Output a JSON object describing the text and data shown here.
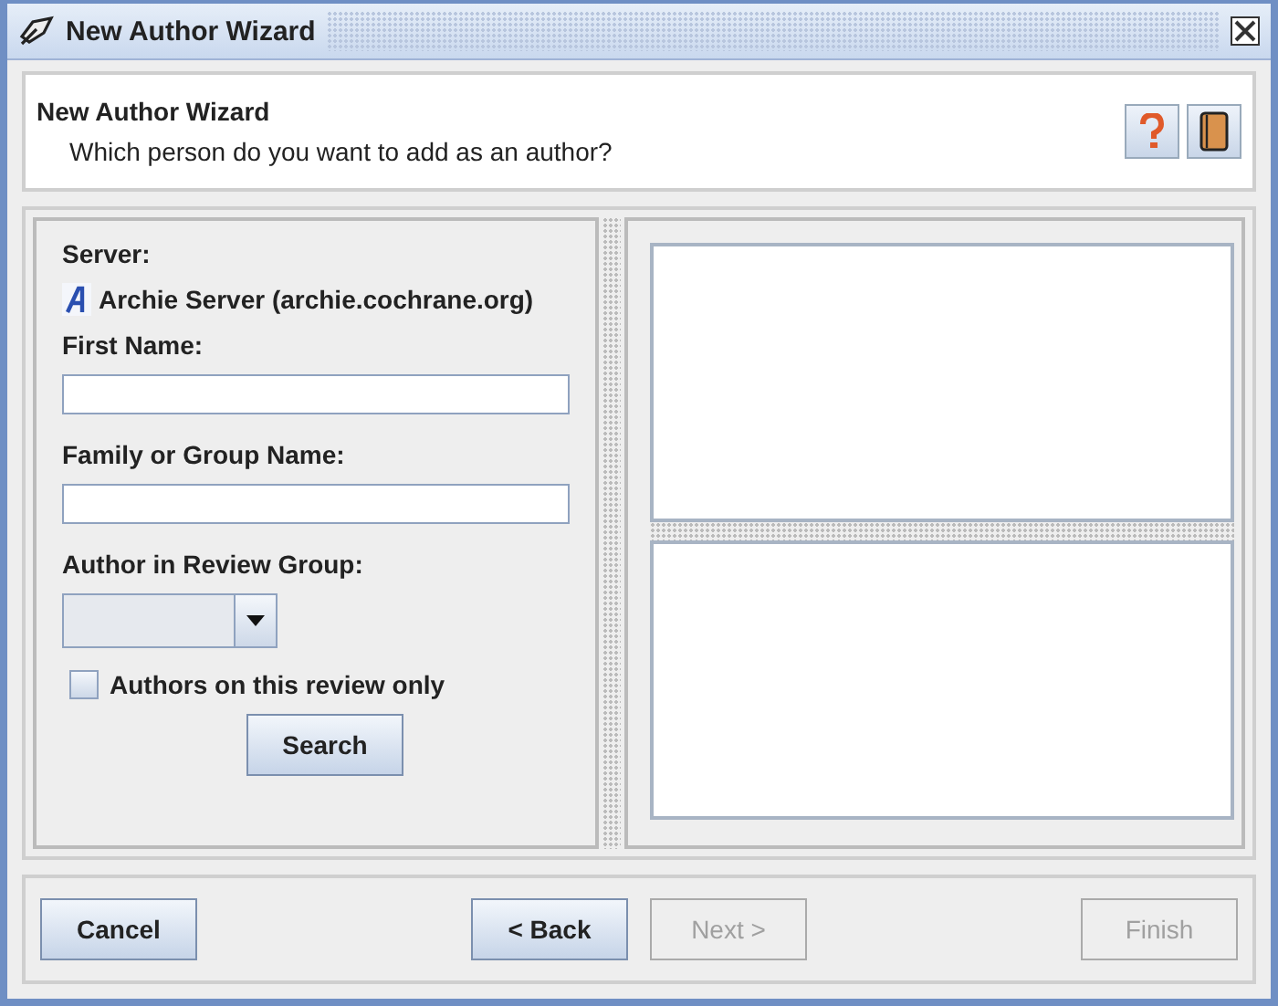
{
  "window": {
    "title": "New Author Wizard"
  },
  "header": {
    "title": "New Author Wizard",
    "subtitle": "Which person do you want to add as an author?"
  },
  "form": {
    "server_label": "Server:",
    "server": "Archie Server (archie.cochrane.org)",
    "fields": [
      {
        "label": "First Name:",
        "kind": "text"
      },
      {
        "label": "Family or Group Name:",
        "kind": "text"
      },
      {
        "label": "Author in Review Group:",
        "kind": "combo"
      }
    ],
    "checkbox": {
      "label": "Authors on this review only",
      "checked": false
    },
    "search_button": {
      "label": "Search"
    }
  },
  "buttons": [
    {
      "label": "Cancel",
      "disabled": false,
      "kind": "left"
    },
    {
      "label": "< Back",
      "disabled": false,
      "kind": "middle"
    },
    {
      "label": "Next >",
      "disabled": true,
      "kind": "middle"
    },
    {
      "label": "Finish",
      "disabled": true,
      "kind": "right"
    }
  ]
}
